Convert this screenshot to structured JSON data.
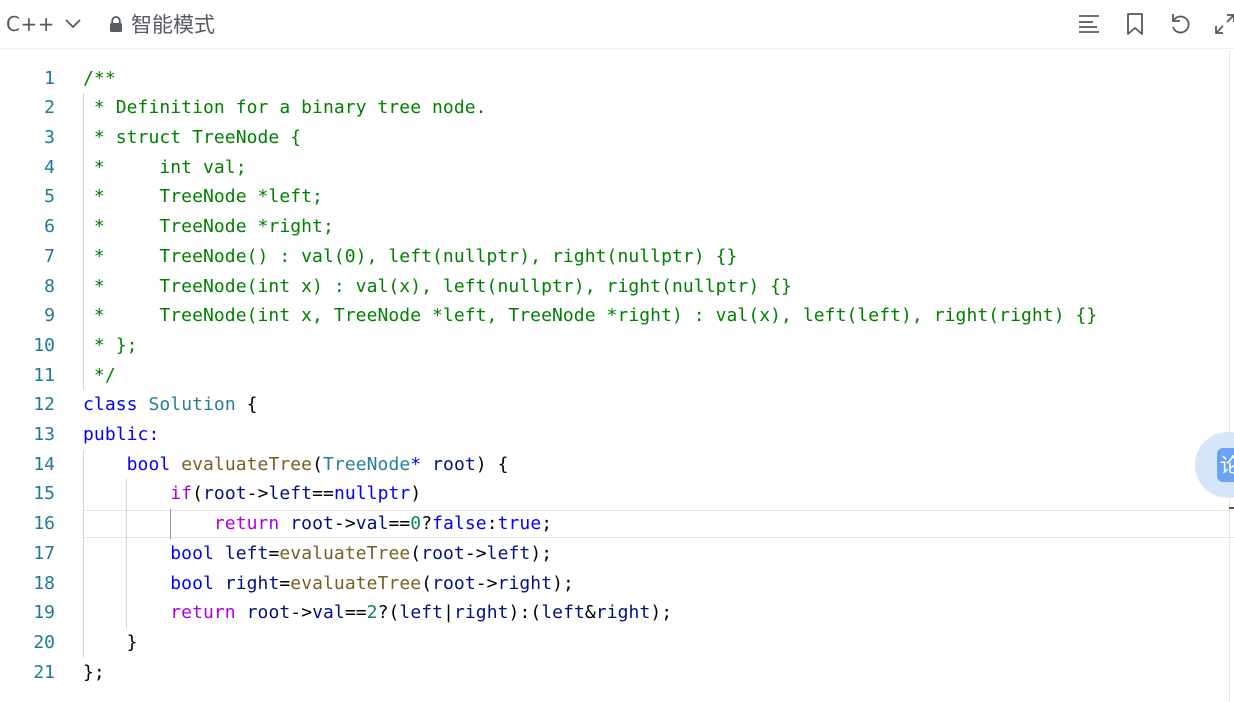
{
  "toolbar": {
    "language": "C++",
    "mode_label": "智能模式",
    "icons": [
      "chevron-down-icon",
      "lock-icon",
      "format-icon",
      "bookmark-icon",
      "undo-icon",
      "fullscreen-icon"
    ]
  },
  "editor": {
    "active_line": 16,
    "lines": [
      {
        "n": "1",
        "tokens": [
          [
            "c",
            "/**"
          ]
        ]
      },
      {
        "n": "2",
        "tokens": [
          [
            "c",
            " * Definition for a binary tree node."
          ]
        ]
      },
      {
        "n": "3",
        "tokens": [
          [
            "c",
            " * struct TreeNode {"
          ]
        ]
      },
      {
        "n": "4",
        "tokens": [
          [
            "c",
            " *     int val;"
          ]
        ]
      },
      {
        "n": "5",
        "tokens": [
          [
            "c",
            " *     TreeNode *left;"
          ]
        ]
      },
      {
        "n": "6",
        "tokens": [
          [
            "c",
            " *     TreeNode *right;"
          ]
        ]
      },
      {
        "n": "7",
        "tokens": [
          [
            "c",
            " *     TreeNode() : val(0), left(nullptr), right(nullptr) {}"
          ]
        ]
      },
      {
        "n": "8",
        "tokens": [
          [
            "c",
            " *     TreeNode(int x) : val(x), left(nullptr), right(nullptr) {}"
          ]
        ]
      },
      {
        "n": "9",
        "tokens": [
          [
            "c",
            " *     TreeNode(int x, TreeNode *left, TreeNode *right) : val(x), left(left), right(right) {}"
          ]
        ]
      },
      {
        "n": "10",
        "tokens": [
          [
            "c",
            " * };"
          ]
        ]
      },
      {
        "n": "11",
        "tokens": [
          [
            "c",
            " */"
          ]
        ]
      },
      {
        "n": "12",
        "tokens": [
          [
            "k",
            "class"
          ],
          [
            "p",
            " "
          ],
          [
            "t",
            "Solution"
          ],
          [
            "p",
            " {"
          ]
        ]
      },
      {
        "n": "13",
        "tokens": [
          [
            "k",
            "public:"
          ]
        ]
      },
      {
        "n": "14",
        "tokens": [
          [
            "p",
            "    "
          ],
          [
            "k",
            "bool"
          ],
          [
            "p",
            " "
          ],
          [
            "f",
            "evaluateTree"
          ],
          [
            "p",
            "("
          ],
          [
            "t",
            "TreeNode"
          ],
          [
            "k",
            "*"
          ],
          [
            "p",
            " "
          ],
          [
            "v",
            "root"
          ],
          [
            "p",
            ") {"
          ]
        ]
      },
      {
        "n": "15",
        "tokens": [
          [
            "p",
            "        "
          ],
          [
            "kw",
            "if"
          ],
          [
            "p",
            "("
          ],
          [
            "v",
            "root"
          ],
          [
            "p",
            "->"
          ],
          [
            "v",
            "left"
          ],
          [
            "p",
            "=="
          ],
          [
            "k",
            "nullptr"
          ],
          [
            "p",
            ")"
          ]
        ]
      },
      {
        "n": "16",
        "tokens": [
          [
            "p",
            "            "
          ],
          [
            "kw",
            "return"
          ],
          [
            "p",
            " "
          ],
          [
            "v",
            "root"
          ],
          [
            "p",
            "->"
          ],
          [
            "v",
            "val"
          ],
          [
            "p",
            "=="
          ],
          [
            "n",
            "0"
          ],
          [
            "p",
            "?"
          ],
          [
            "k",
            "false"
          ],
          [
            "p",
            ":"
          ],
          [
            "k",
            "true"
          ],
          [
            "p",
            ";"
          ]
        ]
      },
      {
        "n": "17",
        "tokens": [
          [
            "p",
            "        "
          ],
          [
            "k",
            "bool"
          ],
          [
            "p",
            " "
          ],
          [
            "v",
            "left"
          ],
          [
            "p",
            "="
          ],
          [
            "f",
            "evaluateTree"
          ],
          [
            "p",
            "("
          ],
          [
            "v",
            "root"
          ],
          [
            "p",
            "->"
          ],
          [
            "v",
            "left"
          ],
          [
            "p",
            ");"
          ]
        ]
      },
      {
        "n": "18",
        "tokens": [
          [
            "p",
            "        "
          ],
          [
            "k",
            "bool"
          ],
          [
            "p",
            " "
          ],
          [
            "v",
            "right"
          ],
          [
            "p",
            "="
          ],
          [
            "f",
            "evaluateTree"
          ],
          [
            "p",
            "("
          ],
          [
            "v",
            "root"
          ],
          [
            "p",
            "->"
          ],
          [
            "v",
            "right"
          ],
          [
            "p",
            ");"
          ]
        ]
      },
      {
        "n": "19",
        "tokens": [
          [
            "p",
            "        "
          ],
          [
            "kw",
            "return"
          ],
          [
            "p",
            " "
          ],
          [
            "v",
            "root"
          ],
          [
            "p",
            "->"
          ],
          [
            "v",
            "val"
          ],
          [
            "p",
            "=="
          ],
          [
            "n",
            "2"
          ],
          [
            "p",
            "?("
          ],
          [
            "v",
            "left"
          ],
          [
            "p",
            "|"
          ],
          [
            "v",
            "right"
          ],
          [
            "p",
            "):("
          ],
          [
            "v",
            "left"
          ],
          [
            "p",
            "&"
          ],
          [
            "v",
            "right"
          ],
          [
            "p",
            ");"
          ]
        ]
      },
      {
        "n": "20",
        "tokens": [
          [
            "p",
            "    }"
          ]
        ]
      },
      {
        "n": "21",
        "tokens": [
          [
            "p",
            "};"
          ]
        ]
      }
    ]
  },
  "floating_button": {
    "label": "论"
  }
}
